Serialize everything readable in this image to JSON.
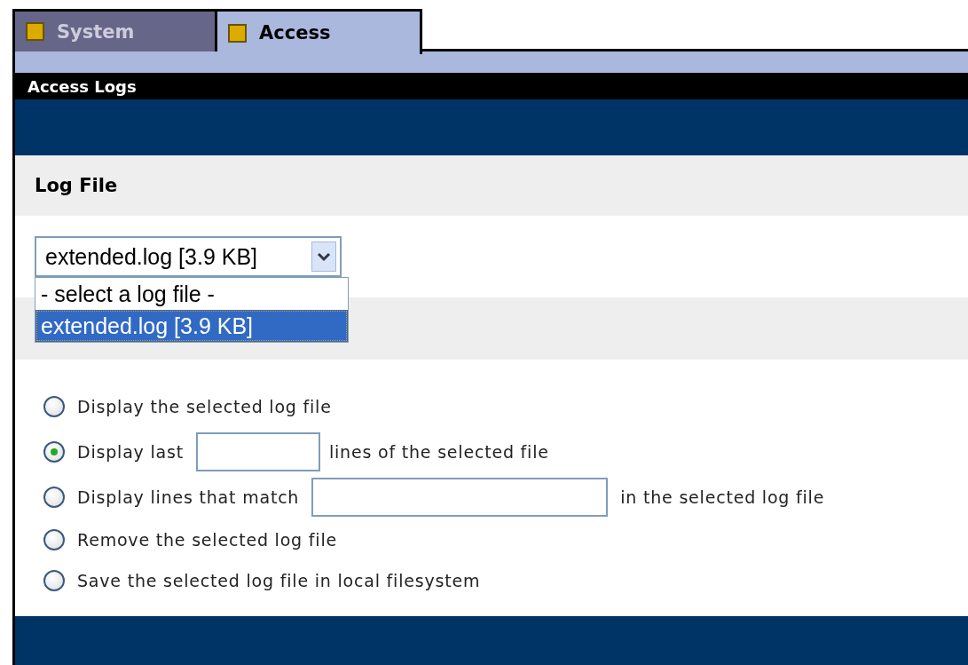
{
  "tabs": [
    {
      "label": "System",
      "selected": false
    },
    {
      "label": "Access",
      "selected": true
    }
  ],
  "section_title": "Access Logs",
  "log_file": {
    "heading": "Log File",
    "value": "extended.log [3.9 KB]",
    "expanded": true,
    "options": [
      {
        "label": "- select a log file -",
        "selected": false
      },
      {
        "label": "extended.log [3.9 KB]",
        "selected": true
      }
    ]
  },
  "actions": [
    {
      "kind": "plain",
      "label": "Display the selected log file",
      "selected": false
    },
    {
      "kind": "count",
      "label": "Display last",
      "after": "lines of the selected file",
      "selected": true
    },
    {
      "kind": "match",
      "label": "Display lines that match",
      "after": "in the selected log file",
      "selected": false
    },
    {
      "kind": "plain",
      "label": "Remove the selected log file",
      "selected": false
    },
    {
      "kind": "plain",
      "label": "Save the selected log file in local filesystem",
      "selected": false
    }
  ]
}
